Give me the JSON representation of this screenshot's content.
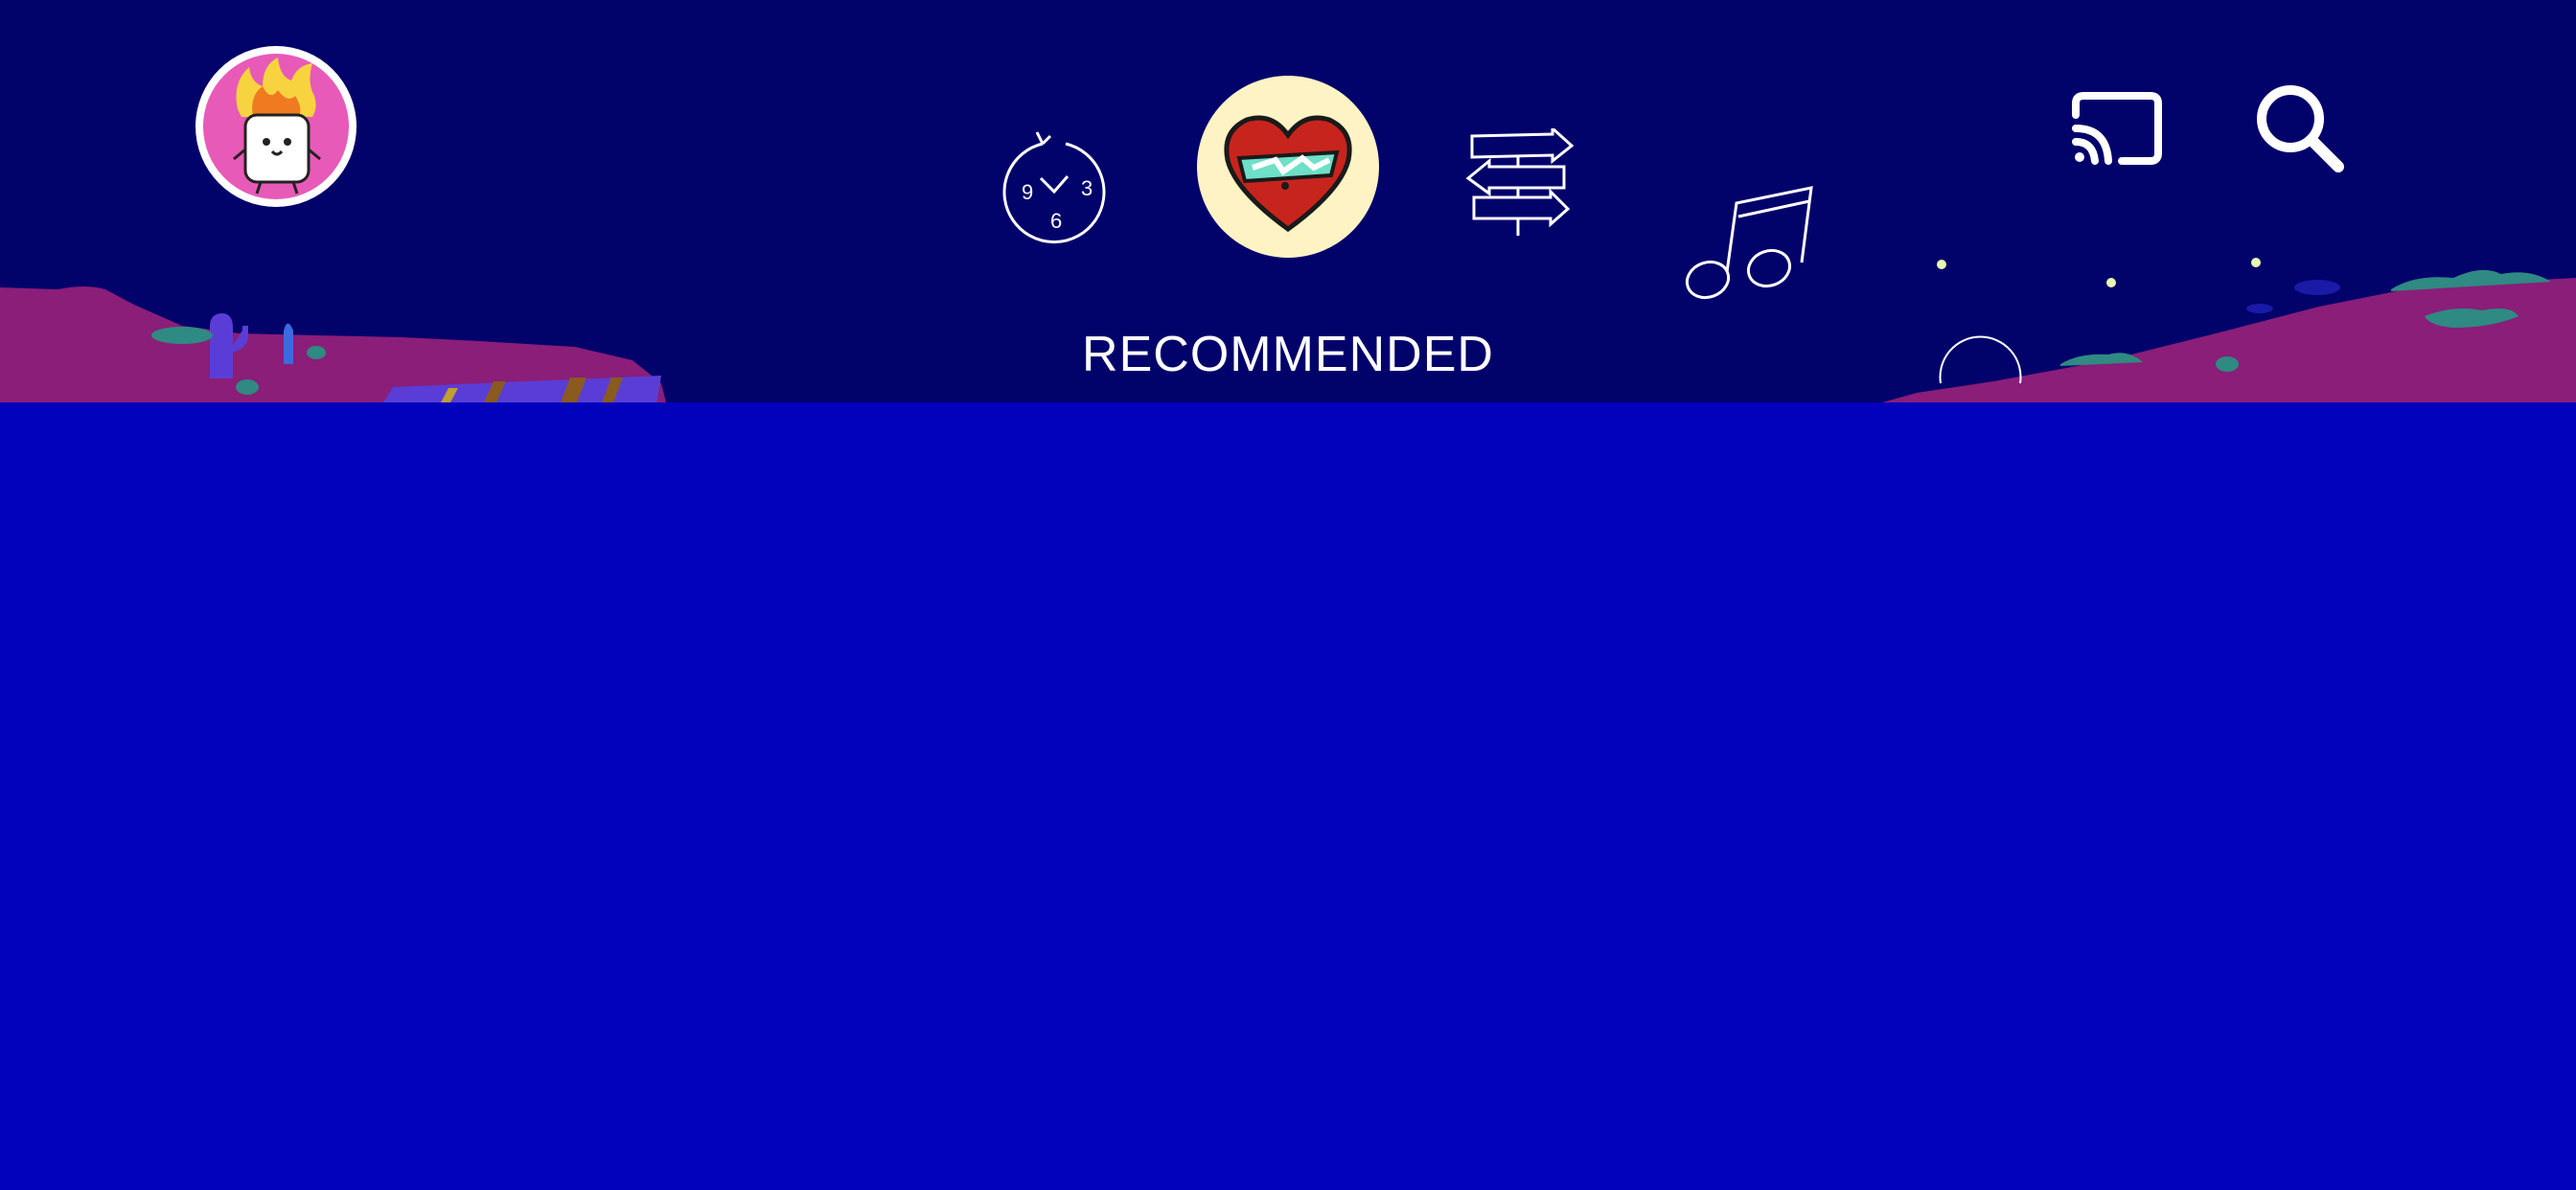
{
  "header": {
    "profile": {
      "icon": "flaming-marshmallow-avatar"
    },
    "nav": [
      {
        "id": "history",
        "icon": "clock-rewind-icon"
      },
      {
        "id": "recommended",
        "icon": "heart-icon",
        "active": true
      },
      {
        "id": "explore",
        "icon": "signpost-icon"
      },
      {
        "id": "music",
        "icon": "music-note-icon"
      }
    ],
    "active_label": "RECOMMENDED",
    "clock_numbers": {
      "left": "9",
      "bottom": "6",
      "right": "3"
    },
    "actions": [
      {
        "id": "cast",
        "icon": "cast-icon"
      },
      {
        "id": "search",
        "icon": "search-icon"
      }
    ]
  },
  "colors": {
    "sky": "#02026b",
    "water": "#0202bd",
    "land": "#8a1e78",
    "accent": "#fdf3c4",
    "avatar_bg": "#e85ab8",
    "text": "#ffffff"
  }
}
